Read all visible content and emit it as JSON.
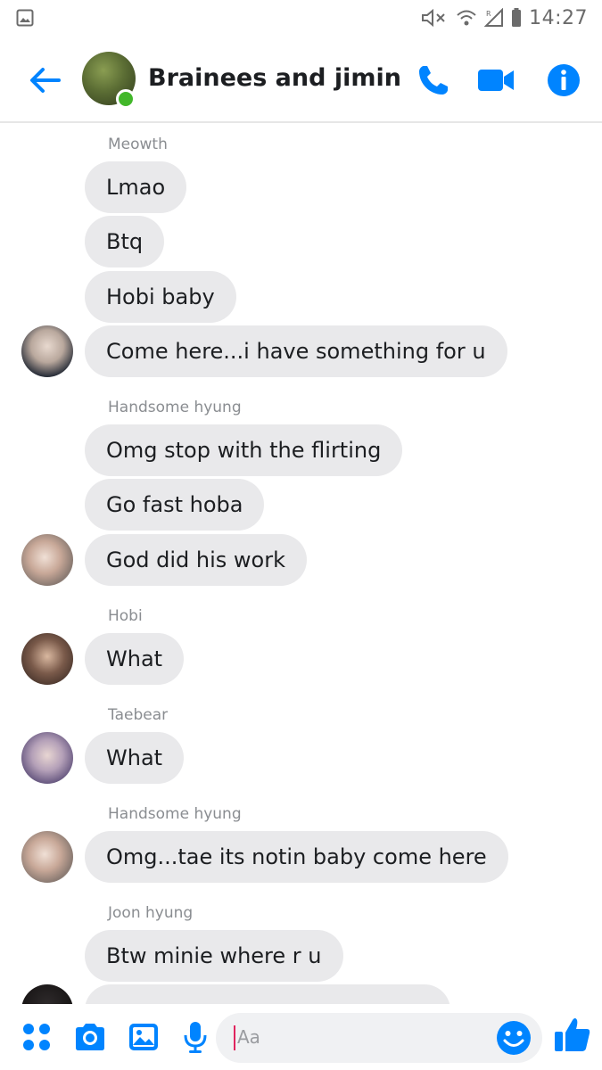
{
  "statusbar": {
    "time": "14:27"
  },
  "header": {
    "title": "Brainees and jimin",
    "accent": "#0084ff",
    "online_color": "#42b72a"
  },
  "messages": {
    "senders": [
      "Meowth",
      "Handsome hyung",
      "Hobi",
      "Taebear",
      "Handsome hyung",
      "Joon hyung"
    ],
    "groups": [
      {
        "sender": "Meowth",
        "bubbles": [
          "Lmao",
          "Btq",
          "Hobi baby",
          "Come here...i have something for u"
        ]
      },
      {
        "sender": "Handsome hyung",
        "bubbles": [
          "Omg stop with the flirting",
          "Go fast hoba",
          "God did his work"
        ]
      },
      {
        "sender": "Hobi",
        "bubbles": [
          "What"
        ]
      },
      {
        "sender": "Taebear",
        "bubbles": [
          "What"
        ]
      },
      {
        "sender": "Handsome hyung",
        "bubbles": [
          "Omg...tae its notin baby come here"
        ]
      },
      {
        "sender": "Joon hyung",
        "bubbles": [
          "Btw minie where r u"
        ]
      }
    ],
    "bubble_color": "#e9e9eb"
  },
  "composer": {
    "placeholder": "Aa",
    "icons": [
      "apps-icon",
      "camera-icon",
      "image-icon",
      "mic-icon",
      "emoji-icon",
      "thumbs-up-icon"
    ]
  }
}
